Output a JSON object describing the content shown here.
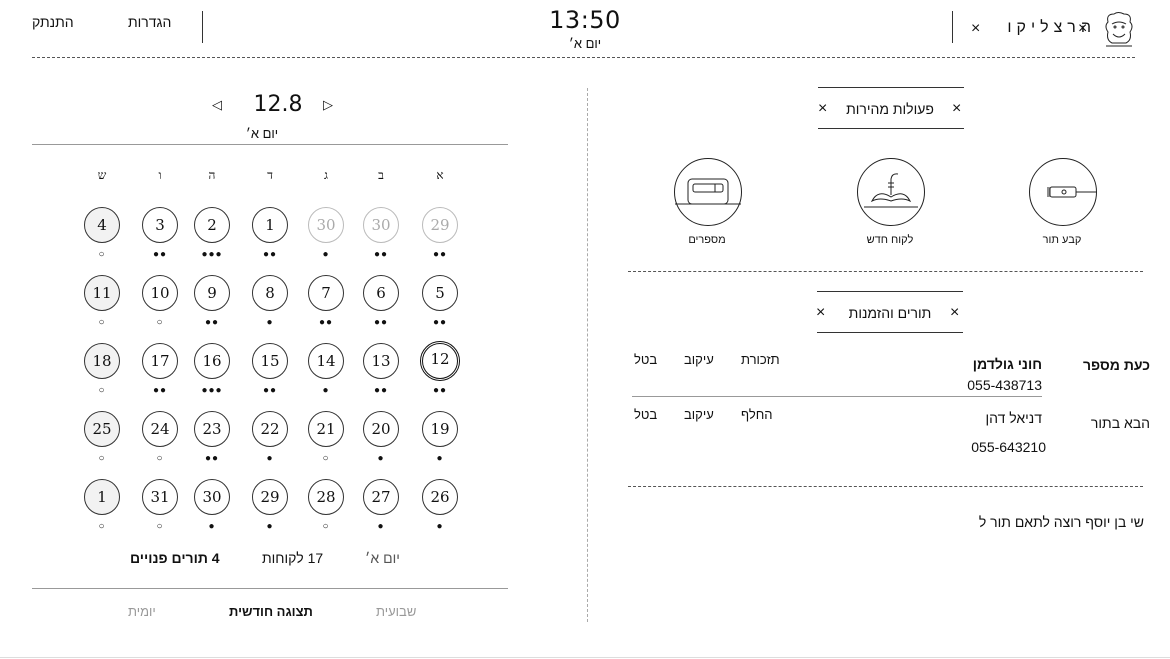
{
  "header": {
    "logout": "התנתק",
    "settings": "הגדרות",
    "time": "13:50",
    "day": "יום א׳",
    "brand": "הרצליקו"
  },
  "quick_actions": {
    "title": "פעולות מהירות",
    "items": [
      {
        "label": "קבע תור",
        "icon": "trimmer-icon"
      },
      {
        "label": "לקוח חדש",
        "icon": "mustache-icon"
      },
      {
        "label": "מספרים",
        "icon": "card-icon"
      }
    ]
  },
  "appointments": {
    "title": "תורים והזמנות",
    "now": {
      "heading": "כעת מספר",
      "name": "חוני גולדמן",
      "phone": "055-438713",
      "actions": [
        "תזכורת",
        "עיקוב",
        "בטל"
      ]
    },
    "next": {
      "heading": "הבא בתור",
      "name": "דניאל דהן",
      "phone": "055-643210",
      "actions": [
        "החלף",
        "עיקוב",
        "בטל"
      ]
    },
    "note": "שי בן יוסף רוצה לתאם תור ל"
  },
  "calendar": {
    "date": "12.8",
    "day": "יום א׳",
    "weekdays": [
      "א",
      "ב",
      "ג",
      "ד",
      "ה",
      "ו",
      "ש"
    ],
    "weeks": [
      [
        {
          "d": "29",
          "dots": "●●",
          "style": "grey"
        },
        {
          "d": "30",
          "dots": "●●",
          "style": "grey"
        },
        {
          "d": "30",
          "dots": "●",
          "style": "grey"
        },
        {
          "d": "1",
          "dots": "●●"
        },
        {
          "d": "2",
          "dots": "●●●"
        },
        {
          "d": "3",
          "dots": "●●"
        },
        {
          "d": "4",
          "dots": "○",
          "style": "fill"
        }
      ],
      [
        {
          "d": "5",
          "dots": "●●"
        },
        {
          "d": "6",
          "dots": "●●"
        },
        {
          "d": "7",
          "dots": "●●"
        },
        {
          "d": "8",
          "dots": "●"
        },
        {
          "d": "9",
          "dots": "●●"
        },
        {
          "d": "10",
          "dots": "○"
        },
        {
          "d": "11",
          "dots": "○",
          "style": "fill"
        }
      ],
      [
        {
          "d": "12",
          "dots": "●●",
          "style": "sel"
        },
        {
          "d": "13",
          "dots": "●●"
        },
        {
          "d": "14",
          "dots": "●"
        },
        {
          "d": "15",
          "dots": "●●"
        },
        {
          "d": "16",
          "dots": "●●●"
        },
        {
          "d": "17",
          "dots": "●●"
        },
        {
          "d": "18",
          "dots": "○",
          "style": "fill"
        }
      ],
      [
        {
          "d": "19",
          "dots": "●"
        },
        {
          "d": "20",
          "dots": "●"
        },
        {
          "d": "21",
          "dots": "○"
        },
        {
          "d": "22",
          "dots": "●"
        },
        {
          "d": "23",
          "dots": "●●"
        },
        {
          "d": "24",
          "dots": "○"
        },
        {
          "d": "25",
          "dots": "○",
          "style": "fill"
        }
      ],
      [
        {
          "d": "26",
          "dots": "●"
        },
        {
          "d": "27",
          "dots": "●"
        },
        {
          "d": "28",
          "dots": "○"
        },
        {
          "d": "29",
          "dots": "●"
        },
        {
          "d": "30",
          "dots": "●"
        },
        {
          "d": "31",
          "dots": "○"
        },
        {
          "d": "1",
          "dots": "○",
          "style": "fill"
        }
      ]
    ],
    "stats": {
      "day": "יום א׳",
      "customers": "17 לקוחות",
      "free": "4 תורים פנויים"
    },
    "tabs": {
      "weekly": "שבועית",
      "monthly": "תצוגה חודשית",
      "daily": "יומית"
    }
  }
}
